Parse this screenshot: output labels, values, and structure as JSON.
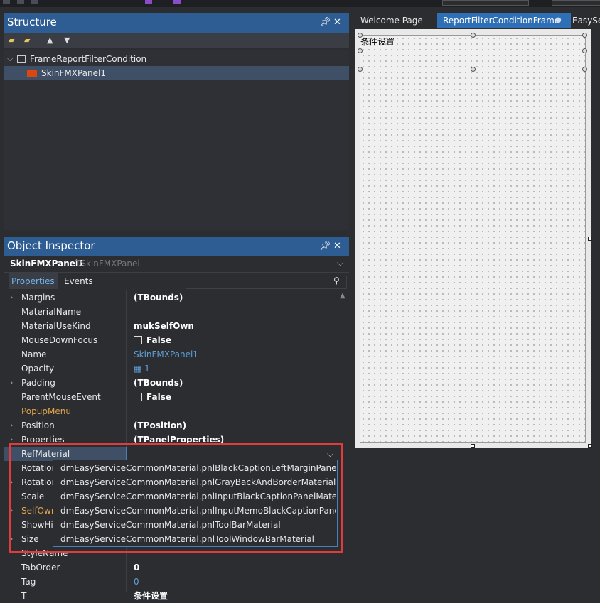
{
  "structure": {
    "title": "Structure",
    "tree": [
      {
        "label": "FrameReportFilterCondition"
      },
      {
        "label": "SkinFMXPanel1"
      }
    ]
  },
  "inspector": {
    "title": "Object Inspector",
    "component_name": "SkinFMXPanel1",
    "component_type": "TSkinFMXPanel",
    "tabs": [
      "Properties",
      "Events"
    ],
    "properties": [
      {
        "name": "Margins",
        "value": "(TBounds)"
      },
      {
        "name": "MaterialName",
        "value": ""
      },
      {
        "name": "MaterialUseKind",
        "value": "mukSelfOwn"
      },
      {
        "name": "MouseDownFocus",
        "value": "False"
      },
      {
        "name": "Name",
        "value": "SkinFMXPanel1"
      },
      {
        "name": "Opacity",
        "value": "1"
      },
      {
        "name": "Padding",
        "value": "(TBounds)"
      },
      {
        "name": "ParentMouseEvent",
        "value": "False"
      },
      {
        "name": "PopupMenu",
        "value": ""
      },
      {
        "name": "Position",
        "value": "(TPosition)"
      },
      {
        "name": "Properties",
        "value": "(TPanelProperties)"
      },
      {
        "name": "RefMaterial",
        "value": ""
      },
      {
        "name": "Rotation",
        "value": ""
      },
      {
        "name": "Rotation",
        "value": ""
      },
      {
        "name": "Scale",
        "value": ""
      },
      {
        "name": "SelfOwn",
        "value": ""
      },
      {
        "name": "ShowHir",
        "value": ""
      },
      {
        "name": "Size",
        "value": ""
      },
      {
        "name": "StyleName",
        "value": ""
      },
      {
        "name": "TabOrder",
        "value": "0"
      },
      {
        "name": "Tag",
        "value": "0"
      },
      {
        "name": "T",
        "value": "条件设置"
      }
    ],
    "dropdown_options": [
      "dmEasyServiceCommonMaterial.pnlBlackCaptionLeftMarginPanelMaterial",
      "dmEasyServiceCommonMaterial.pnlGrayBackAndBorderMaterial",
      "dmEasyServiceCommonMaterial.pnlInputBlackCaptionPanelMaterial",
      "dmEasyServiceCommonMaterial.pnlInputMemoBlackCaptionPanelMaterial",
      "dmEasyServiceCommonMaterial.pnlToolBarMaterial",
      "dmEasyServiceCommonMaterial.pnlToolWindowBarMaterial"
    ]
  },
  "designer": {
    "tabs": [
      "Welcome Page",
      "ReportFilterConditionFrame",
      "EasySer"
    ],
    "form_caption": "条件设置"
  },
  "colors": {
    "accent": "#2d5d92",
    "highlight_box": "#e23b3b",
    "tab_active": "#2f6fb6"
  }
}
